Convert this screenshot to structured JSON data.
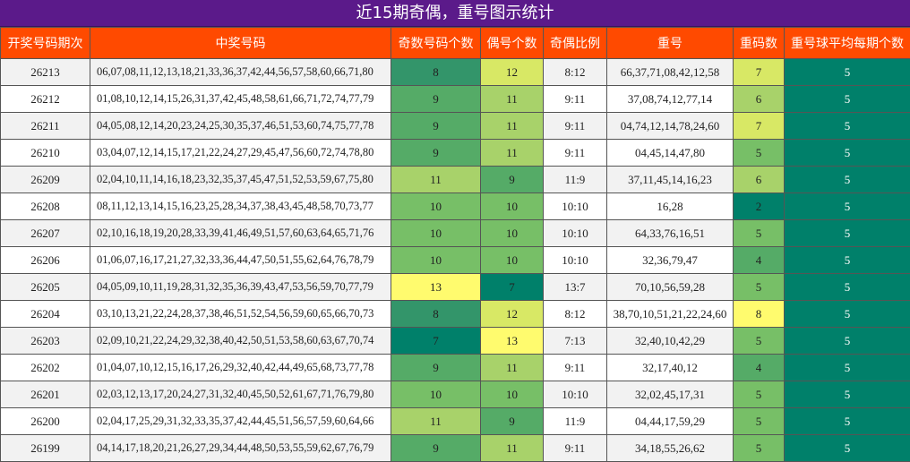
{
  "title": "近15期奇偶，重号图示统计",
  "headers": [
    "开奖号码期次",
    "中奖号码",
    "奇数号码个数",
    "偶号个数",
    "奇偶比例",
    "重号",
    "重码数",
    "重号球平均每期个数"
  ],
  "colors": {
    "title_bg": "#5b1a8a",
    "header_bg": "#ff4a00",
    "scale": {
      "2": "#00806a",
      "4": "#55ab67",
      "5": "#77bf67",
      "6": "#a8d26a",
      "7": "#d8e865",
      "8": "#fffb6e"
    },
    "parity_scale": {
      "7": "#00806a",
      "8": "#33956a",
      "9": "#55ab67",
      "10": "#77bf67",
      "11": "#a8d26a",
      "12": "#d8e865",
      "13": "#fffb6e"
    },
    "avg_bg": "#00806a"
  },
  "rows": [
    {
      "period": "26213",
      "numbers": "06,07,08,11,12,13,18,21,33,36,37,42,44,56,57,58,60,66,71,80",
      "odd": "8",
      "even": "12",
      "ratio": "8:12",
      "repeat": "66,37,71,08,42,12,58",
      "repeat_count": "7",
      "avg": "5"
    },
    {
      "period": "26212",
      "numbers": "01,08,10,12,14,15,26,31,37,42,45,48,58,61,66,71,72,74,77,79",
      "odd": "9",
      "even": "11",
      "ratio": "9:11",
      "repeat": "37,08,74,12,77,14",
      "repeat_count": "6",
      "avg": "5"
    },
    {
      "period": "26211",
      "numbers": "04,05,08,12,14,20,23,24,25,30,35,37,46,51,53,60,74,75,77,78",
      "odd": "9",
      "even": "11",
      "ratio": "9:11",
      "repeat": "04,74,12,14,78,24,60",
      "repeat_count": "7",
      "avg": "5"
    },
    {
      "period": "26210",
      "numbers": "03,04,07,12,14,15,17,21,22,24,27,29,45,47,56,60,72,74,78,80",
      "odd": "9",
      "even": "11",
      "ratio": "9:11",
      "repeat": "04,45,14,47,80",
      "repeat_count": "5",
      "avg": "5"
    },
    {
      "period": "26209",
      "numbers": "02,04,10,11,14,16,18,23,32,35,37,45,47,51,52,53,59,67,75,80",
      "odd": "11",
      "even": "9",
      "ratio": "11:9",
      "repeat": "37,11,45,14,16,23",
      "repeat_count": "6",
      "avg": "5"
    },
    {
      "period": "26208",
      "numbers": "08,11,12,13,14,15,16,23,25,28,34,37,38,43,45,48,58,70,73,77",
      "odd": "10",
      "even": "10",
      "ratio": "10:10",
      "repeat": "16,28",
      "repeat_count": "2",
      "avg": "5"
    },
    {
      "period": "26207",
      "numbers": "02,10,16,18,19,20,28,33,39,41,46,49,51,57,60,63,64,65,71,76",
      "odd": "10",
      "even": "10",
      "ratio": "10:10",
      "repeat": "64,33,76,16,51",
      "repeat_count": "5",
      "avg": "5"
    },
    {
      "period": "26206",
      "numbers": "01,06,07,16,17,21,27,32,33,36,44,47,50,51,55,62,64,76,78,79",
      "odd": "10",
      "even": "10",
      "ratio": "10:10",
      "repeat": "32,36,79,47",
      "repeat_count": "4",
      "avg": "5"
    },
    {
      "period": "26205",
      "numbers": "04,05,09,10,11,19,28,31,32,35,36,39,43,47,53,56,59,70,77,79",
      "odd": "13",
      "even": "7",
      "ratio": "13:7",
      "repeat": "70,10,56,59,28",
      "repeat_count": "5",
      "avg": "5"
    },
    {
      "period": "26204",
      "numbers": "03,10,13,21,22,24,28,37,38,46,51,52,54,56,59,60,65,66,70,73",
      "odd": "8",
      "even": "12",
      "ratio": "8:12",
      "repeat": "38,70,10,51,21,22,24,60",
      "repeat_count": "8",
      "avg": "5"
    },
    {
      "period": "26203",
      "numbers": "02,09,10,21,22,24,29,32,38,40,42,50,51,53,58,60,63,67,70,74",
      "odd": "7",
      "even": "13",
      "ratio": "7:13",
      "repeat": "32,40,10,42,29",
      "repeat_count": "5",
      "avg": "5"
    },
    {
      "period": "26202",
      "numbers": "01,04,07,10,12,15,16,17,26,29,32,40,42,44,49,65,68,73,77,78",
      "odd": "9",
      "even": "11",
      "ratio": "9:11",
      "repeat": "32,17,40,12",
      "repeat_count": "4",
      "avg": "5"
    },
    {
      "period": "26201",
      "numbers": "02,03,12,13,17,20,24,27,31,32,40,45,50,52,61,67,71,76,79,80",
      "odd": "10",
      "even": "10",
      "ratio": "10:10",
      "repeat": "32,02,45,17,31",
      "repeat_count": "5",
      "avg": "5"
    },
    {
      "period": "26200",
      "numbers": "02,04,17,25,29,31,32,33,35,37,42,44,45,51,56,57,59,60,64,66",
      "odd": "11",
      "even": "9",
      "ratio": "11:9",
      "repeat": "04,44,17,59,29",
      "repeat_count": "5",
      "avg": "5"
    },
    {
      "period": "26199",
      "numbers": "04,14,17,18,20,21,26,27,29,34,44,48,50,53,55,59,62,67,76,79",
      "odd": "9",
      "even": "11",
      "ratio": "9:11",
      "repeat": "34,18,55,26,62",
      "repeat_count": "5",
      "avg": "5"
    }
  ]
}
